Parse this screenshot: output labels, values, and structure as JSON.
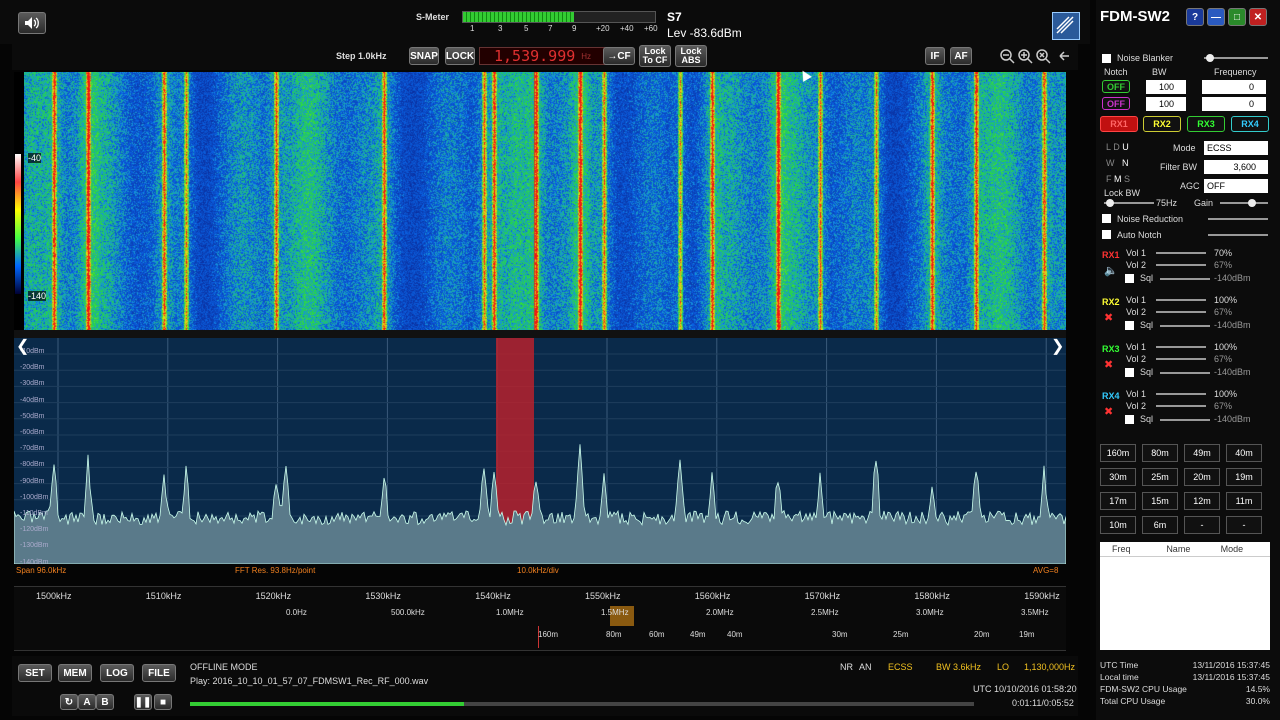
{
  "smeter": {
    "label": "S-Meter",
    "scale": [
      "1",
      "3",
      "5",
      "7",
      "9",
      "+20",
      "+40",
      "+60"
    ],
    "s_value": "S7",
    "level": "Lev -83.6dBm",
    "fill": 0.58
  },
  "controls": {
    "step": "Step 1.0kHz",
    "snap": "SNAP",
    "lock": "LOCK",
    "frequency": "1,539.999",
    "freq_unit": "Hz",
    "cf": "→CF",
    "lock_to_cf": [
      "Lock",
      "To CF"
    ],
    "lock_abs": [
      "Lock",
      "ABS"
    ],
    "if": "IF",
    "af": "AF"
  },
  "waterfall": {
    "levels": [
      "-40",
      "-140"
    ]
  },
  "spectrum": {
    "db_labels": [
      "-10dBm",
      "-20dBm",
      "-30dBm",
      "-40dBm",
      "-50dBm",
      "-60dBm",
      "-70dBm",
      "-80dBm",
      "-90dBm",
      "-100dBm",
      "-110dBm",
      "-120dBm",
      "-130dBm",
      "-140dBm"
    ],
    "span": "Span 96.0kHz",
    "fft": "FFT Res. 93.8Hz/point",
    "div": "10.0kHz/div",
    "avg": "AVG=8"
  },
  "freq_scale": [
    "1500kHz",
    "1510kHz",
    "1520kHz",
    "1530kHz",
    "1540kHz",
    "1550kHz",
    "1560kHz",
    "1570kHz",
    "1580kHz",
    "1590kHz"
  ],
  "band_scale": [
    "0.0Hz",
    "500.0kHz",
    "1.0MHz",
    "1.5MHz",
    "2.0MHz",
    "2.5MHz",
    "3.0MHz",
    "3.5MHz"
  ],
  "meter_scale": [
    "160m",
    "80m",
    "60m",
    "49m",
    "40m",
    "30m",
    "25m",
    "20m",
    "19m"
  ],
  "bottom_buttons": {
    "set": "SET",
    "mem": "MEM",
    "log": "LOG",
    "file": "FILE",
    "a": "A",
    "b": "B"
  },
  "status": {
    "mode_title": "OFFLINE MODE",
    "play": "Play: 2016_10_10_01_57_07_FDMSW1_Rec_RF_000.wav",
    "nr": "NR",
    "an": "AN",
    "ecss": "ECSS",
    "bw": "BW 3.6kHz",
    "lo": "LO",
    "lo_freq": "1,130,000Hz",
    "utc": "UTC 10/10/2016 01:58:20",
    "time": "0:01:11/0:05:52",
    "progress": 0.35
  },
  "right": {
    "title": "FDM-SW2",
    "help": "?",
    "noise_blanker": "Noise Blanker",
    "notch": "Notch",
    "bw": "BW",
    "frequency": "Frequency",
    "notch_rows": [
      {
        "state": "OFF",
        "bw": "100",
        "freq": "0"
      },
      {
        "state": "OFF",
        "bw": "100",
        "freq": "0"
      }
    ],
    "rx_tabs": [
      "RX1",
      "RX2",
      "RX3",
      "RX4"
    ],
    "mode_label": "Mode",
    "mode": "ECSS",
    "filter_bw_label": "Filter BW",
    "filter_bw": "3,600",
    "agc_label": "AGC",
    "agc": "OFF",
    "ldu": [
      "L",
      "D",
      "U"
    ],
    "wn": [
      "W",
      "N"
    ],
    "fms": [
      "F",
      "M",
      "S"
    ],
    "lock_bw": "Lock BW",
    "lock_bw_val": "75Hz",
    "gain": "Gain",
    "noise_reduction": "Noise Reduction",
    "auto_notch": "Auto Notch",
    "rx": [
      {
        "name": "RX1",
        "vol1": "Vol 1",
        "v1": "70%",
        "vol2": "Vol 2",
        "v2": "67%",
        "sql": "Sql",
        "sqlv": "-140dBm"
      },
      {
        "name": "RX2",
        "vol1": "Vol 1",
        "v1": "100%",
        "vol2": "Vol 2",
        "v2": "67%",
        "sql": "Sql",
        "sqlv": "-140dBm"
      },
      {
        "name": "RX3",
        "vol1": "Vol 1",
        "v1": "100%",
        "vol2": "Vol 2",
        "v2": "67%",
        "sql": "Sql",
        "sqlv": "-140dBm"
      },
      {
        "name": "RX4",
        "vol1": "Vol 1",
        "v1": "100%",
        "vol2": "Vol 2",
        "v2": "67%",
        "sql": "Sql",
        "sqlv": "-140dBm"
      }
    ],
    "bands": [
      "160m",
      "80m",
      "49m",
      "40m",
      "30m",
      "25m",
      "20m",
      "19m",
      "17m",
      "15m",
      "12m",
      "11m",
      "10m",
      "6m",
      "-",
      "-"
    ],
    "mem_cols": [
      "Freq",
      "Name",
      "Mode"
    ],
    "info": [
      {
        "k": "UTC Time",
        "v": "13/11/2016 15:37:45"
      },
      {
        "k": "Local time",
        "v": "13/11/2016 15:37:45"
      },
      {
        "k": "FDM-SW2 CPU Usage",
        "v": "14.5%"
      },
      {
        "k": "Total CPU Usage",
        "v": "30.0%"
      }
    ]
  },
  "colors": {
    "accent": "#f0c020",
    "waterfall_bg": "#1050c0",
    "spectrum_bg": "#0a2a4a",
    "filter": "#c0202a"
  }
}
